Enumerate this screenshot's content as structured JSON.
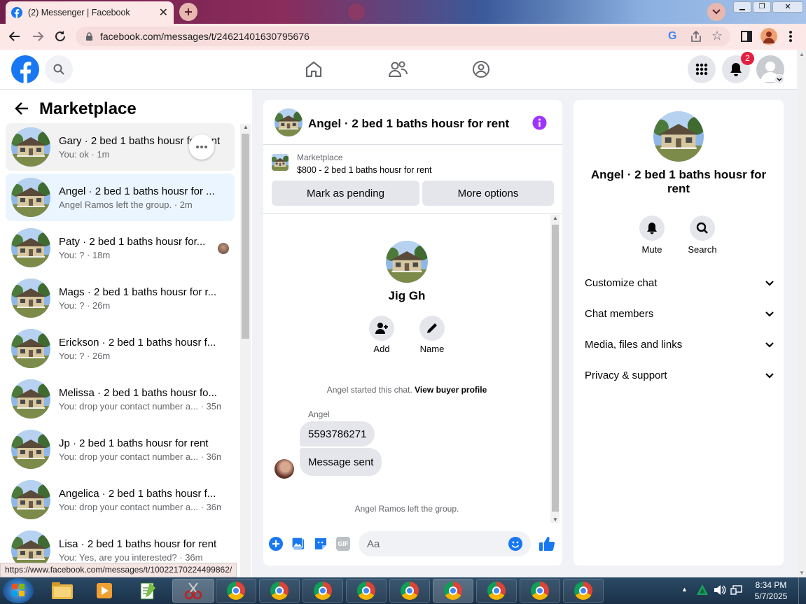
{
  "browser": {
    "active_tab_title": "(2) Messenger | Facebook",
    "url": "facebook.com/messages/t/24621401630795676",
    "status_url": "https://www.facebook.com/messages/t/10022170224499862/"
  },
  "fb": {
    "notification_count": "2"
  },
  "left": {
    "title": "Marketplace",
    "conversations": [
      {
        "name": "Gary · 2 bed 1 baths housr for rent",
        "sub": "You: ok · 1m"
      },
      {
        "name": "Angel · 2 bed 1 baths housr for ...",
        "sub": "Angel Ramos left the group. · 2m"
      },
      {
        "name": "Paty · 2 bed 1 baths housr for...",
        "sub": "You: ? · 18m"
      },
      {
        "name": "Mags · 2 bed 1 baths housr for r...",
        "sub": "You: ? · 26m"
      },
      {
        "name": "Erickson · 2 bed 1 baths housr f...",
        "sub": "You: ? · 26m"
      },
      {
        "name": "Melissa · 2 bed 1 baths housr fo...",
        "sub": "You: drop your contact number a... · 35m"
      },
      {
        "name": "Jp · 2 bed 1 baths housr for rent",
        "sub": "You: drop your contact number a... · 36m"
      },
      {
        "name": "Angelica · 2 bed 1 baths housr f...",
        "sub": "You: drop your contact number a... · 36m"
      },
      {
        "name": "Lisa · 2 bed 1 baths housr for rent",
        "sub": "You: Yes, are you interested? · 36m"
      }
    ]
  },
  "chat": {
    "title": "Angel · 2 bed 1 baths housr for rent",
    "listing_source": "Marketplace",
    "listing_desc": "$800 - 2 bed 1 baths housr for rent",
    "mark_pending": "Mark as pending",
    "more_options": "More options",
    "group_name": "Jig Gh",
    "add_label": "Add",
    "name_label": "Name",
    "started_text": "Angel started this chat.",
    "view_buyer": "View buyer profile",
    "sender": "Angel",
    "messages": [
      "5593786271",
      "Message sent"
    ],
    "left_text": "Angel Ramos left the group.",
    "composer_placeholder": "Aa"
  },
  "info": {
    "title": "Angel · 2 bed 1 baths housr for rent",
    "mute": "Mute",
    "search": "Search",
    "sections": [
      "Customize chat",
      "Chat members",
      "Media, files and links",
      "Privacy & support"
    ]
  },
  "taskbar": {
    "time": "8:34 PM",
    "date": "5/7/2025"
  },
  "colors": {
    "fb_blue": "#1877f2",
    "purple": "#a033ff",
    "badge": "#e41e3f"
  }
}
